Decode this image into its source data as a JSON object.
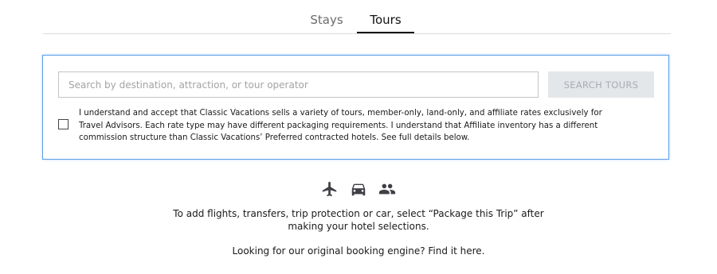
{
  "tabs": {
    "stays_label": "Stays",
    "tours_label": "Tours",
    "active": "Tours"
  },
  "search": {
    "placeholder": "Search by destination, attraction, or tour operator",
    "value": "",
    "button_label": "SEARCH TOURS"
  },
  "agreement": {
    "checked": false,
    "text": "I understand and accept that Classic Vacations sells a variety of tours, member-only, land-only, and affiliate rates exclusively for Travel Advisors. Each rate type may have different packaging requirements. I understand that Affiliate inventory has a different commission structure than Classic Vacations’ Preferred contracted hotels. See full details below."
  },
  "icons": [
    "airplane-icon",
    "car-icon",
    "people-icon"
  ],
  "info": {
    "line1": "To add flights, transfers, trip protection or car, select “Package this Trip” after",
    "line2": "making your hotel selections.",
    "legacy": "Looking for our original booking engine? Find it here."
  },
  "colors": {
    "active_tab": "#111111",
    "inactive_tab": "#6b6b6b",
    "card_border": "#5b9ee8",
    "button_bg": "#e4e7ea",
    "button_text": "#a8adb2",
    "icon": "#3f3f46"
  }
}
